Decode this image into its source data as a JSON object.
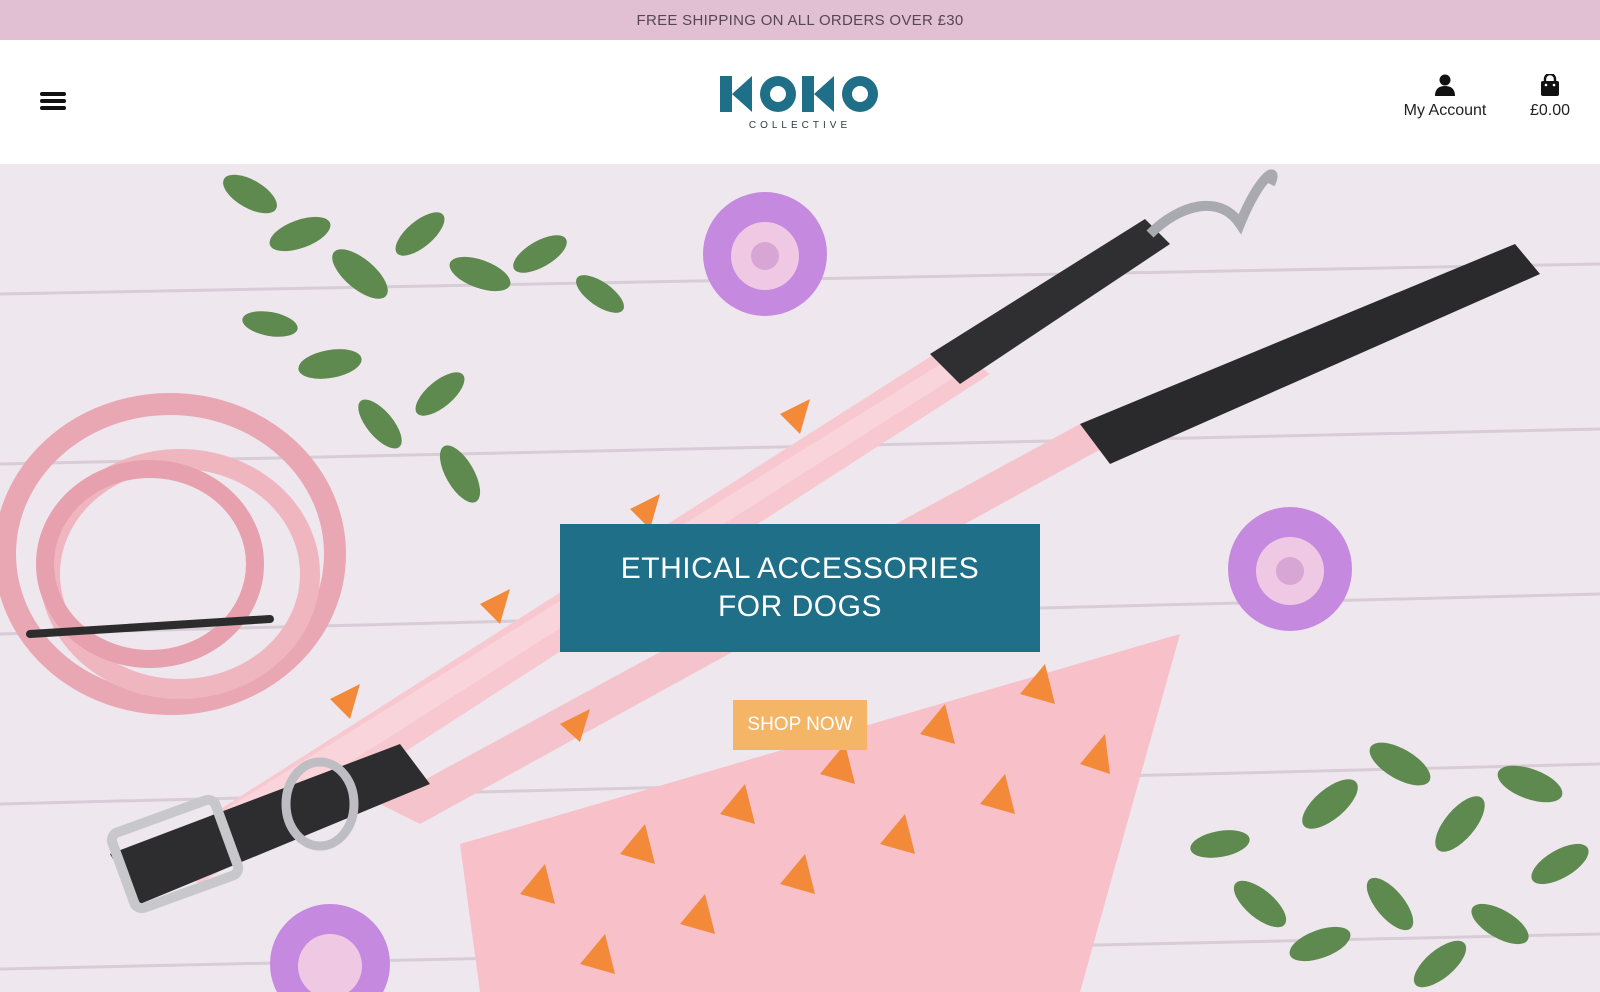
{
  "announcement": {
    "text": "FREE SHIPPING ON ALL ORDERS OVER £30"
  },
  "header": {
    "menu_icon": "hamburger-menu-icon",
    "logo": {
      "text": "KOKO",
      "subtext": "COLLECTIVE"
    },
    "account": {
      "icon": "user-icon",
      "label": "My Account"
    },
    "cart": {
      "icon": "shopping-bag-icon",
      "total": "£0.00"
    }
  },
  "hero": {
    "title": "ETHICAL ACCESSORIES FOR DOGS",
    "cta_label": "SHOP NOW"
  },
  "colors": {
    "announcement_bg": "#e2c0d4",
    "brand_teal": "#1e6f87",
    "cta_orange": "#f5b566"
  }
}
